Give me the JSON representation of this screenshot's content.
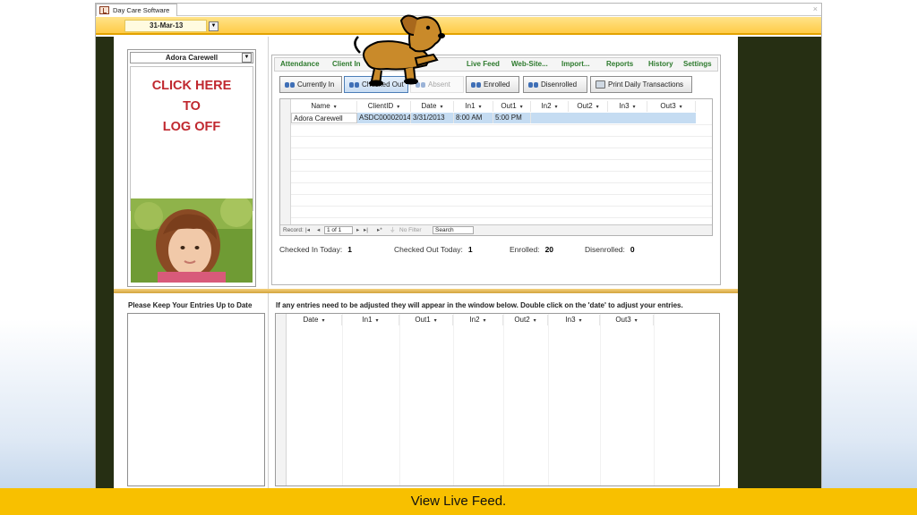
{
  "window": {
    "tab_title": "Day Care Software"
  },
  "datebar": {
    "date": "31-Mar-13"
  },
  "left_panel": {
    "user_name": "Adora Carewell",
    "logoff_line1": "CLICK HERE",
    "logoff_line2": "TO",
    "logoff_line3": "LOG OFF"
  },
  "nav_tabs": [
    "Attendance",
    "Client In",
    "Live Feed",
    "Web-Site...",
    "Import...",
    "Reports",
    "History",
    "Settings"
  ],
  "toolbar": {
    "currently_in": "Currently In",
    "checked_out": "Checked Out",
    "absent": "Absent",
    "enrolled": "Enrolled",
    "disenrolled": "Disenrolled",
    "print_daily": "Print Daily Transactions"
  },
  "attendance_grid": {
    "columns": [
      "Name",
      "ClientID",
      "Date",
      "In1",
      "Out1",
      "In2",
      "Out2",
      "In3",
      "Out3"
    ],
    "rows": [
      {
        "name": "Adora Carewell",
        "client_id": "ASDC00002014",
        "date": "3/31/2013",
        "in1": "8:00 AM",
        "out1": "5:00 PM",
        "in2": "",
        "out2": "",
        "in3": "",
        "out3": ""
      }
    ],
    "record_nav": {
      "label": "Record:",
      "position": "1 of 1",
      "filter": "No Filter",
      "search": "Search"
    }
  },
  "stats": {
    "checked_in_label": "Checked In Today:",
    "checked_in_value": "1",
    "checked_out_label": "Checked Out Today:",
    "checked_out_value": "1",
    "enrolled_label": "Enrolled:",
    "enrolled_value": "20",
    "disenrolled_label": "Disenrolled:",
    "disenrolled_value": "0"
  },
  "lower": {
    "left_title": "Please Keep Your Entries Up to Date",
    "right_title": "If any entries need to be adjusted they will appear in the window below. Double click on the 'date' to adjust your entries.",
    "columns": [
      "Date",
      "In1",
      "Out1",
      "In2",
      "Out2",
      "In3",
      "Out3"
    ]
  },
  "caption": "View Live Feed.",
  "colors": {
    "accent_yellow": "#f8c000",
    "frame_green": "#262f13",
    "logoff_red": "#c0282f",
    "tab_green": "#2d7a2d"
  }
}
